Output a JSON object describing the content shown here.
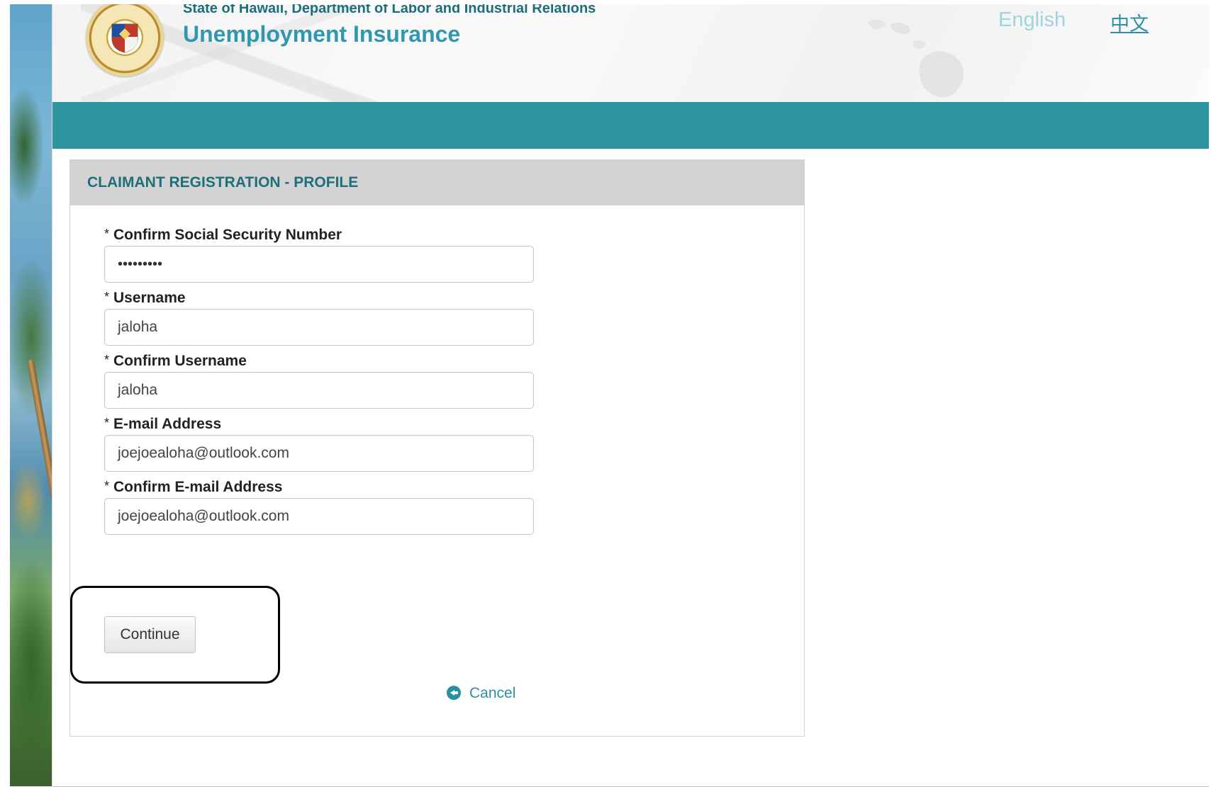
{
  "header": {
    "department": "State of Hawaii, Department of Labor and Industrial Relations",
    "app_title": "Unemployment Insurance",
    "language_english": "English",
    "language_chinese": "中文"
  },
  "panel": {
    "title": "CLAIMANT REGISTRATION - PROFILE",
    "required_marker": "*",
    "fields": [
      {
        "label": "Confirm Social Security Number",
        "value": "•••••••••",
        "type": "password"
      },
      {
        "label": "Username",
        "value": "jaloha",
        "type": "text"
      },
      {
        "label": "Confirm Username",
        "value": "jaloha",
        "type": "text"
      },
      {
        "label": "E-mail Address",
        "value": "joejoealoha@outlook.com",
        "type": "text"
      },
      {
        "label": "Confirm E-mail Address",
        "value": "joejoealoha@outlook.com",
        "type": "text"
      }
    ],
    "continue_label": "Continue",
    "cancel_label": "Cancel"
  },
  "colors": {
    "teal_band": "#2e95a0",
    "title_teal": "#2f98b0",
    "panel_header_gray": "#d3d3d3",
    "link_teal": "#2b8fa3"
  },
  "icons": {
    "seal": "state-seal-icon",
    "cancel": "circle-arrow-left-icon"
  }
}
